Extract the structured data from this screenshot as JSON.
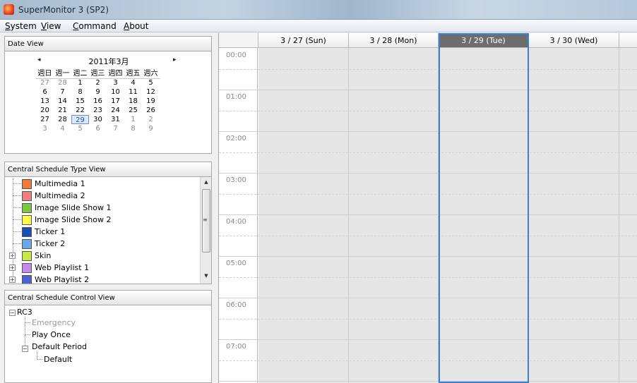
{
  "window": {
    "title": "SuperMonitor 3 (SP2)"
  },
  "menu": [
    {
      "label": "System",
      "mnemonic": "S",
      "rest": "ystem"
    },
    {
      "label": "View",
      "mnemonic": "V",
      "rest": "iew"
    },
    {
      "label": "Command",
      "mnemonic": "C",
      "rest": "ommand"
    },
    {
      "label": "About",
      "mnemonic": "A",
      "rest": "bout"
    }
  ],
  "date_view": {
    "header": "Date View",
    "month_label": "2011年3月",
    "prev_icon": "◂",
    "next_icon": "▸",
    "weekdays": [
      "週日",
      "週一",
      "週二",
      "週三",
      "週四",
      "週五",
      "週六"
    ],
    "weeks": [
      [
        "27",
        "28",
        "1",
        "2",
        "3",
        "4",
        "5"
      ],
      [
        "6",
        "7",
        "8",
        "9",
        "10",
        "11",
        "12"
      ],
      [
        "13",
        "14",
        "15",
        "16",
        "17",
        "18",
        "19"
      ],
      [
        "20",
        "21",
        "22",
        "23",
        "24",
        "25",
        "26"
      ],
      [
        "27",
        "28",
        "29",
        "30",
        "31",
        "1",
        "2"
      ],
      [
        "3",
        "4",
        "5",
        "6",
        "7",
        "8",
        "9"
      ]
    ],
    "selected_day": "29"
  },
  "type_view": {
    "header": "Central Schedule Type View",
    "items": [
      {
        "label": "Multimedia 1",
        "color": "#f07a3a"
      },
      {
        "label": "Multimedia 2",
        "color": "#f08080"
      },
      {
        "label": "Image Slide Show 1",
        "color": "#7dc63f"
      },
      {
        "label": "Image Slide Show 2",
        "color": "#fff94a"
      },
      {
        "label": "Ticker 1",
        "color": "#1a4fb5"
      },
      {
        "label": "Ticker 2",
        "color": "#6aa8ea"
      },
      {
        "label": "Skin",
        "color": "#c8e84a"
      },
      {
        "label": "Web Playlist 1",
        "color": "#c58ae8"
      },
      {
        "label": "Web Playlist 2",
        "color": "#4a63d0"
      }
    ]
  },
  "control_view": {
    "header": "Central Schedule Control View",
    "root": "RC3",
    "children": [
      "Emergency",
      "Play Once",
      "Default Period"
    ],
    "grandchild": "Default"
  },
  "schedule": {
    "days": [
      "3 / 27 (Sun)",
      "3 / 28 (Mon)",
      "3 / 29 (Tue)",
      "3 / 30 (Wed)"
    ],
    "selected_day_index": 2,
    "hours": [
      "00:00",
      "01:00",
      "02:00",
      "03:00",
      "04:00",
      "05:00",
      "06:00",
      "07:00"
    ],
    "selection_color": "#3b7fd6"
  }
}
